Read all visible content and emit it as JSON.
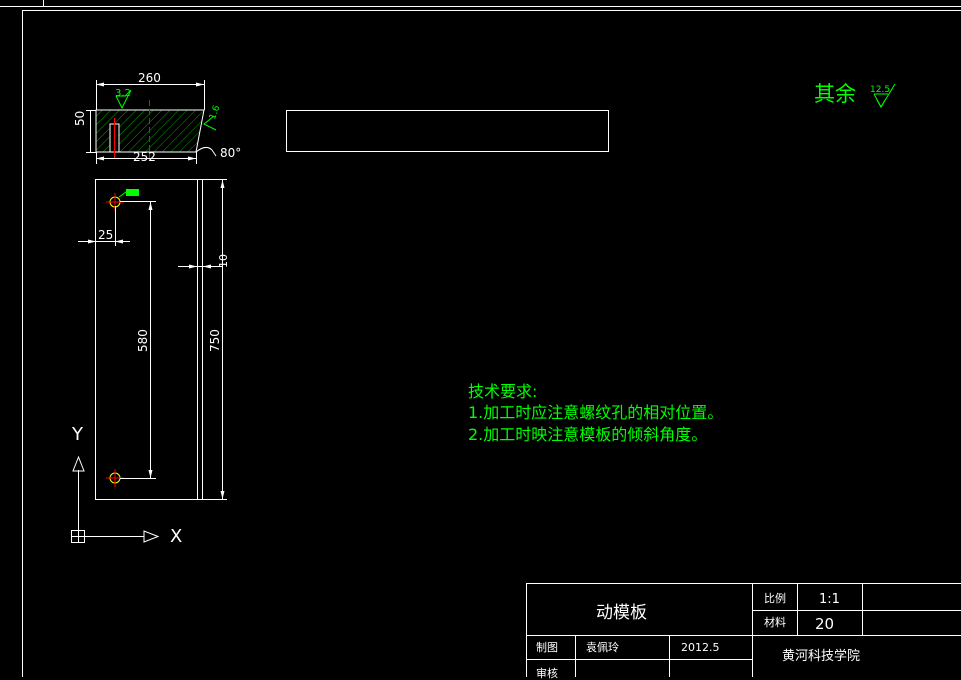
{
  "drawing": {
    "dimensions": {
      "top_width": "260",
      "bottom_width": "252",
      "thickness": "50",
      "hole_offset_x": "25",
      "hole_spacing": "580",
      "length": "750",
      "step": "10",
      "angle": "80°"
    },
    "roughness": {
      "top": "3.2",
      "side": "1.6",
      "rest": "12.5",
      "rest_label": "其余"
    },
    "axes": {
      "y_label": "Y",
      "x_label": "X"
    }
  },
  "notes": {
    "title": "技术要求:",
    "items": [
      "1.加工时应注意螺纹孔的相对位置。",
      "2.加工时映注意模板的倾斜角度。"
    ]
  },
  "title_block": {
    "part_name": "动模板",
    "scale_label": "比例",
    "scale_value": "1:1",
    "material_label": "材料",
    "material_value": "20",
    "drawn_label": "制图",
    "drawn_name": "袁佩玲",
    "drawn_date": "2012.5",
    "review_label": "审核",
    "school": "黄河科技学院"
  },
  "colors": {
    "background": "#000000",
    "lines": "#ffffff",
    "text": "#00ff00",
    "center_line": "#ff0000",
    "hatch": "#00aa00"
  }
}
